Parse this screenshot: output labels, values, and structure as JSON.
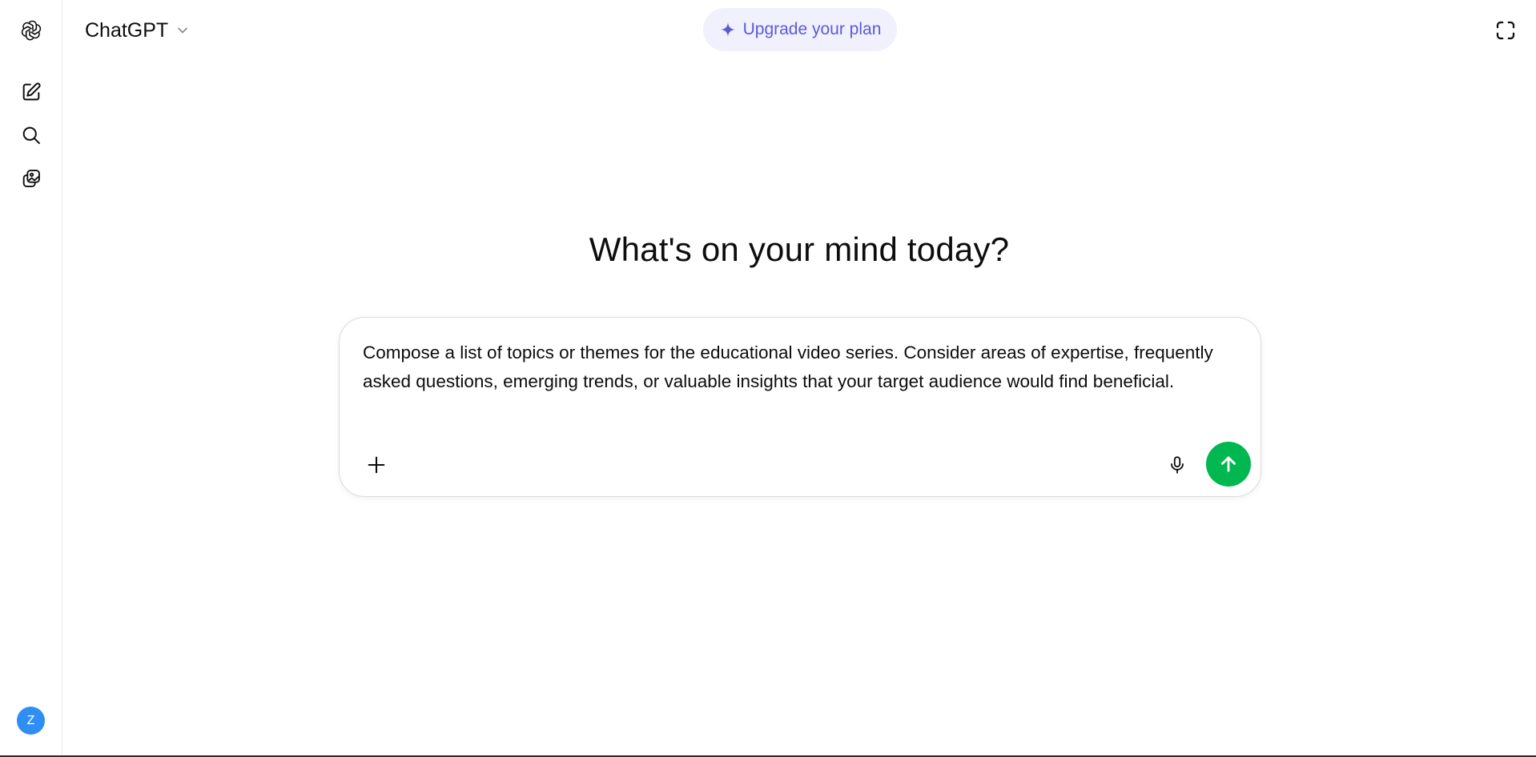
{
  "app": {
    "logo_icon": "openai-logo-icon",
    "title": "ChatGPT"
  },
  "header": {
    "model_name": "ChatGPT",
    "model_dropdown_icon": "chevron-down-icon",
    "upgrade_label": "Upgrade your plan",
    "upgrade_icon": "sparkle-icon",
    "temporary_chat_icon": "dashed-circle-icon"
  },
  "sidebar": {
    "items": [
      {
        "name": "new-chat",
        "icon": "edit-icon"
      },
      {
        "name": "search",
        "icon": "search-icon"
      },
      {
        "name": "library",
        "icon": "images-icon"
      }
    ],
    "avatar_initial": "Z"
  },
  "main": {
    "heading": "What's on your mind today?"
  },
  "composer": {
    "value": "Compose a list of topics or themes for the educational video series. Consider areas of expertise, frequently asked questions, emerging trends, or valuable insights that your target audience would find beneficial.",
    "plus_icon": "plus-icon",
    "mic_icon": "microphone-icon",
    "send_icon": "arrow-up-icon"
  },
  "colors": {
    "upgrade_bg": "#f1f0fd",
    "upgrade_accent": "#5b5bd6",
    "send_button": "#00b84f",
    "avatar": "#2f8ef4",
    "text": "#0d0d0d"
  }
}
